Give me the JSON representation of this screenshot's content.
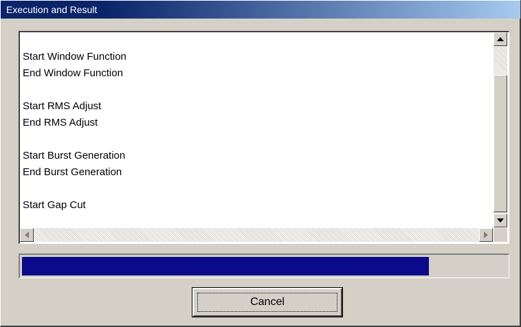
{
  "window": {
    "title": "Execution and Result"
  },
  "log": {
    "lines": [
      "Start Window Function",
      "End Window Function",
      "",
      "Start RMS Adjust",
      "End RMS Adjust",
      "",
      "Start Burst Generation",
      "End Burst Generation",
      "",
      "Start Gap Cut"
    ]
  },
  "progress": {
    "fraction": 0.84,
    "fill_color": "#0a0a8a"
  },
  "buttons": {
    "cancel_label": "Cancel"
  },
  "icons": [
    "scroll-up-arrow-icon",
    "scroll-down-arrow-icon",
    "scroll-left-arrow-icon",
    "scroll-right-arrow-icon"
  ]
}
